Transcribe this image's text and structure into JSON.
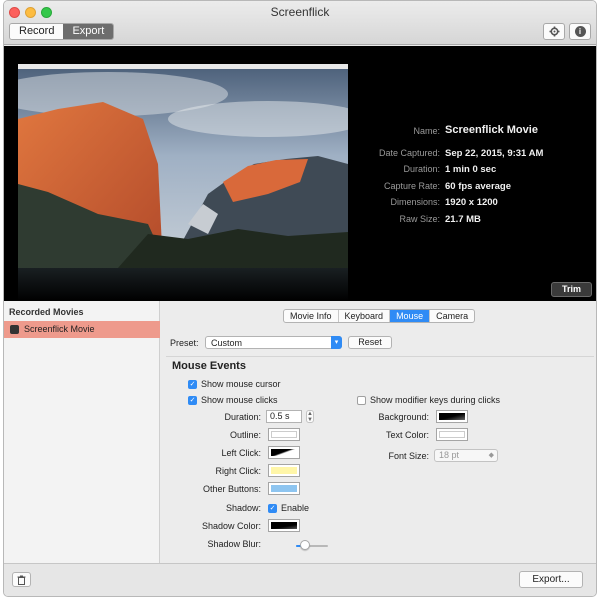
{
  "window": {
    "title": "Screenflick"
  },
  "toolbar": {
    "segments": [
      {
        "label": "Record",
        "selected": false
      },
      {
        "label": "Export",
        "selected": true
      }
    ],
    "settings_icon": "gear-icon",
    "info_icon": "info-icon",
    "info_glyph": "i"
  },
  "preview": {
    "info": [
      {
        "label": "Name:",
        "value": "Screenflick Movie"
      },
      {
        "label": "Date Captured:",
        "value": "Sep 22, 2015, 9:31 AM"
      },
      {
        "label": "Duration:",
        "value": "1 min 0 sec"
      },
      {
        "label": "Capture Rate:",
        "value": "60 fps average"
      },
      {
        "label": "Dimensions:",
        "value": "1920 x 1200"
      },
      {
        "label": "Raw Size:",
        "value": "21.7 MB"
      }
    ],
    "trim_label": "Trim"
  },
  "sidebar": {
    "heading": "Recorded Movies",
    "items": [
      {
        "label": "Screenflick Movie",
        "selected": true
      }
    ]
  },
  "tabs": [
    {
      "label": "Movie Info",
      "selected": false
    },
    {
      "label": "Keyboard",
      "selected": false
    },
    {
      "label": "Mouse",
      "selected": true
    },
    {
      "label": "Camera",
      "selected": false
    }
  ],
  "preset": {
    "label": "Preset:",
    "value": "Custom",
    "reset_label": "Reset"
  },
  "mouse": {
    "section_title": "Mouse Events",
    "show_cursor": {
      "label": "Show mouse cursor",
      "checked": true
    },
    "show_clicks": {
      "label": "Show mouse clicks",
      "checked": true
    },
    "show_modifiers": {
      "label": "Show modifier keys during clicks",
      "checked": false
    },
    "duration": {
      "label": "Duration:",
      "value": "0.5 s"
    },
    "outline": {
      "label": "Outline:",
      "color": "#ffffff"
    },
    "left_click": {
      "label": "Left Click:",
      "color": "#000000"
    },
    "right_click": {
      "label": "Right Click:",
      "color": "#fff6a8"
    },
    "other_buttons": {
      "label": "Other Buttons:",
      "color": "#8ec5f0"
    },
    "shadow": {
      "label": "Shadow:",
      "enable_label": "Enable",
      "checked": true
    },
    "shadow_color": {
      "label": "Shadow Color:",
      "color": "#000000"
    },
    "shadow_blur": {
      "label": "Shadow Blur:",
      "level": 0.28
    },
    "background": {
      "label": "Background:",
      "color": "#000000"
    },
    "text_color": {
      "label": "Text Color:",
      "color": "#ffffff"
    },
    "font_size": {
      "label": "Font Size:",
      "value": "18 pt"
    }
  },
  "footer": {
    "trash_icon": "trash-icon",
    "export_label": "Export..."
  },
  "colors": {
    "accent": "#2f8bf5",
    "selection": "#ee9a8c",
    "preview_bg": "#000000"
  }
}
